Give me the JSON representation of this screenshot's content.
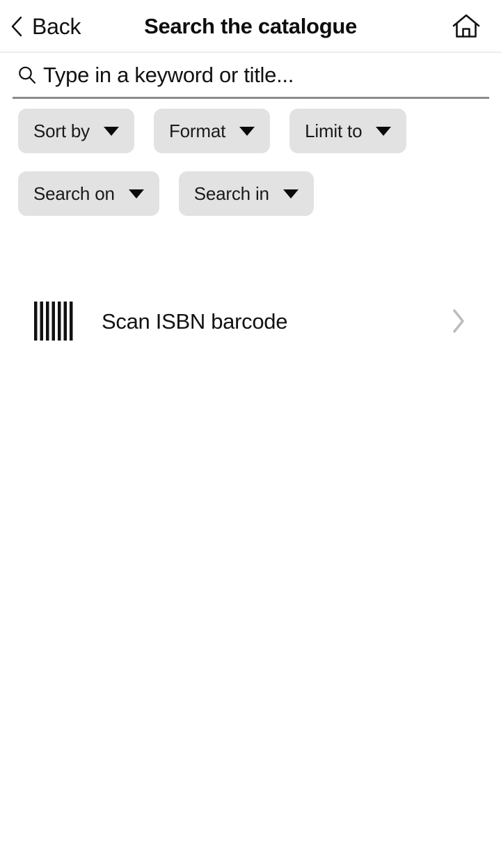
{
  "header": {
    "back_label": "Back",
    "title": "Search the catalogue",
    "back_icon": "chevron-left-icon",
    "home_icon": "home-icon"
  },
  "search": {
    "placeholder": "Type in a keyword or title...",
    "value": "",
    "icon": "search-icon"
  },
  "filters": {
    "chips": [
      {
        "label": "Sort by",
        "icon": "chevron-down-icon"
      },
      {
        "label": "Format",
        "icon": "chevron-down-icon"
      },
      {
        "label": "Limit to",
        "icon": "chevron-down-icon"
      },
      {
        "label": "Search on",
        "icon": "chevron-down-icon"
      },
      {
        "label": "Search in",
        "icon": "chevron-down-icon"
      }
    ]
  },
  "actions": {
    "scan": {
      "label": "Scan ISBN barcode",
      "leading_icon": "barcode-icon",
      "trailing_icon": "chevron-right-icon"
    }
  },
  "colors": {
    "background": "#ffffff",
    "text": "#121212",
    "chip_background": "#e2e2e3",
    "divider": "#ececed",
    "input_underline": "#8a8c8e",
    "chevron_muted": "#bdbdbd"
  }
}
